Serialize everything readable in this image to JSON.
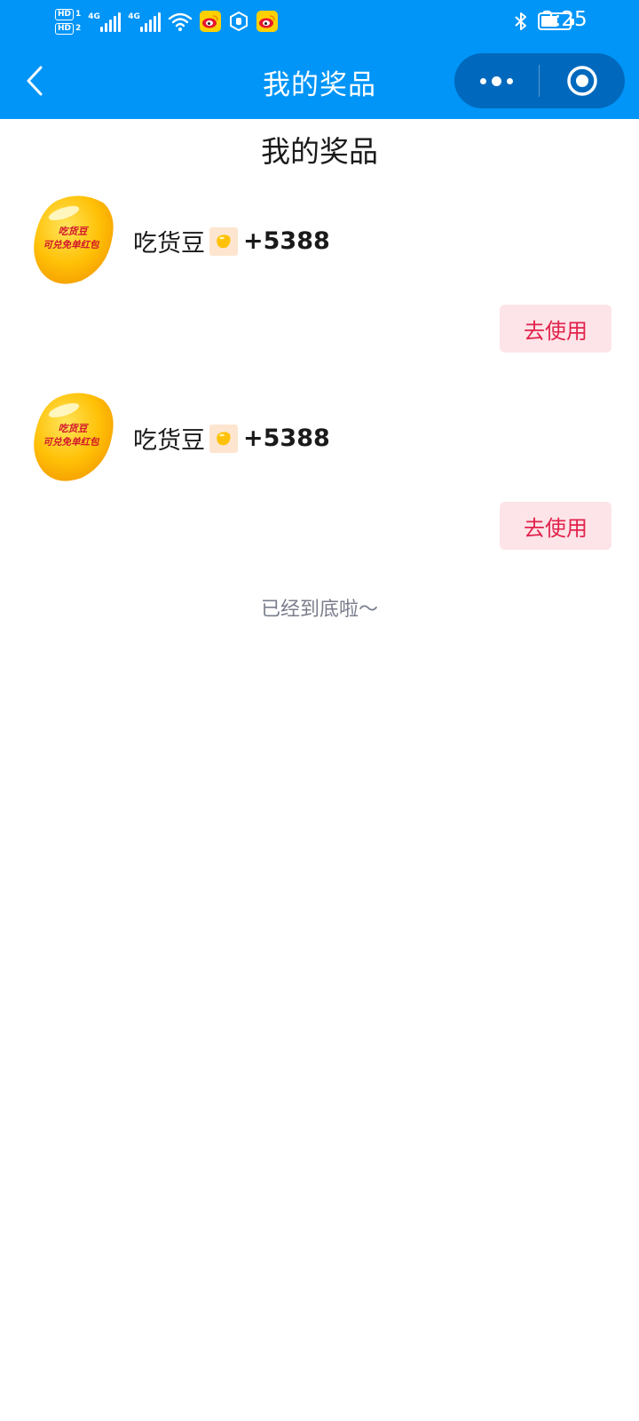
{
  "status_bar": {
    "sim1": "HD",
    "sim1_idx": "1",
    "sim2": "HD",
    "sim2_idx": "2",
    "net1": "4G",
    "net2": "4G",
    "time": "2:25",
    "icons": [
      "hd-icon",
      "signal-icon",
      "signal-icon",
      "wifi-icon",
      "weibo-icon",
      "hexagon-app-icon",
      "weibo-icon",
      "bluetooth-icon",
      "battery-icon"
    ],
    "battery_level": 0.6
  },
  "nav": {
    "title": "我的奖品",
    "back_icon": "chevron-left-icon",
    "more_icon": "more-dots-icon",
    "close_icon": "target-close-icon",
    "bar_color": "#0095f7",
    "capsule_color": "#0069bd"
  },
  "page": {
    "title": "我的奖品",
    "footer": "已经到底啦～"
  },
  "prizes": [
    {
      "image_text_line1": "吃货豆",
      "image_text_line2": "可兑免单红包",
      "name": "吃货豆",
      "amount": "+5388",
      "button": "去使用"
    },
    {
      "image_text_line1": "吃货豆",
      "image_text_line2": "可兑免单红包",
      "name": "吃货豆",
      "amount": "+5388",
      "button": "去使用"
    }
  ],
  "colors": {
    "button_bg": "#fde4e8",
    "button_text": "#e1224b",
    "bean": "#ffc107"
  }
}
